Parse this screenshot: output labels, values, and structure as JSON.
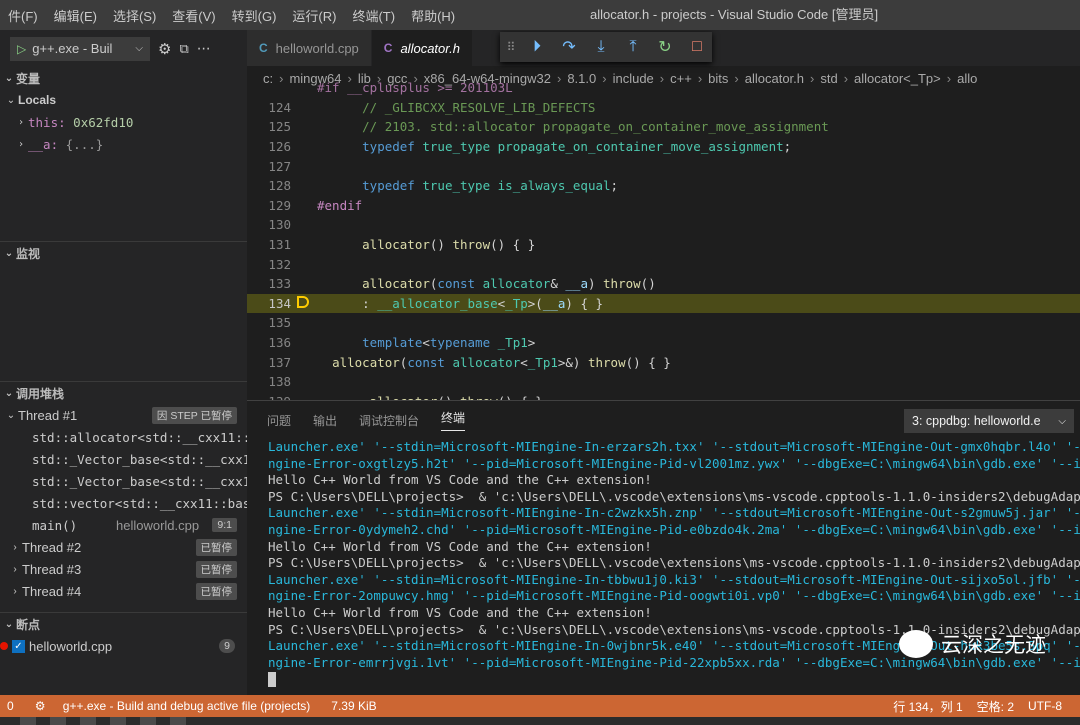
{
  "menu": [
    "件(F)",
    "编辑(E)",
    "选择(S)",
    "查看(V)",
    "转到(G)",
    "运行(R)",
    "终端(T)",
    "帮助(H)"
  ],
  "window_title": "allocator.h - projects - Visual Studio Code [管理员]",
  "sidebar": {
    "config": "g++.exe - Buil",
    "variables_title": "变量",
    "locals_title": "Locals",
    "locals": [
      {
        "name": "this:",
        "value": "0x62fd10"
      },
      {
        "name": "__a:",
        "value": "{...}"
      }
    ],
    "watch_title": "监视",
    "callstack_title": "调用堆栈",
    "thread1": {
      "label": "Thread #1",
      "badge": "因 STEP 已暂停"
    },
    "frames": [
      {
        "label": "std::allocator<std::__cxx11::b"
      },
      {
        "label": "std::_Vector_base<std::__cxx11"
      },
      {
        "label": "std::_Vector_base<std::__cxx11"
      },
      {
        "label": "std::vector<std::__cxx11::bas"
      },
      {
        "label": "main()",
        "file": "helloworld.cpp",
        "pos": "9:1"
      }
    ],
    "threads": [
      {
        "label": "Thread #2",
        "badge": "已暂停"
      },
      {
        "label": "Thread #3",
        "badge": "已暂停"
      },
      {
        "label": "Thread #4",
        "badge": "已暂停"
      }
    ],
    "breakpoints_title": "断点",
    "breakpoint": {
      "label": "helloworld.cpp",
      "count": "9"
    }
  },
  "tabs": [
    {
      "label": "helloworld.cpp",
      "icon": "C"
    },
    {
      "label": "allocator.h",
      "icon": "C"
    }
  ],
  "breadcrumbs": [
    "c:",
    "mingw64",
    "lib",
    "gcc",
    "x86_64-w64-mingw32",
    "8.1.0",
    "include",
    "c++",
    "bits",
    "allocator.h",
    "std",
    "allocator<_Tp>",
    "allo"
  ],
  "code_top_fragment": "#if __cplusplus >= 201103L",
  "code_lines": [
    {
      "n": "124",
      "html": "      <span class='cm'>// _GLIBCXX_RESOLVE_LIB_DEFECTS</span>"
    },
    {
      "n": "125",
      "html": "      <span class='cm'>// 2103. std::allocator propagate_on_container_move_assignment</span>"
    },
    {
      "n": "126",
      "html": "      <span class='k'>typedef</span> <span class='t'>true_type</span> <span class='t'>propagate_on_container_move_assignment</span>;"
    },
    {
      "n": "127",
      "html": ""
    },
    {
      "n": "128",
      "html": "      <span class='k'>typedef</span> <span class='t'>true_type</span> <span class='t'>is_always_equal</span>;"
    },
    {
      "n": "129",
      "html": "<span class='pp'>#endif</span>"
    },
    {
      "n": "130",
      "html": ""
    },
    {
      "n": "131",
      "html": "      <span class='f'>allocator</span>() <span class='f'>throw</span>() { }"
    },
    {
      "n": "132",
      "html": ""
    },
    {
      "n": "133",
      "html": "      <span class='f'>allocator</span>(<span class='k'>const</span> <span class='t'>allocator</span>&amp; <span class='v'>__a</span>) <span class='f'>throw</span>()"
    },
    {
      "n": "134",
      "html": "      : <span class='t'>__allocator_base</span>&lt;<span class='t'>_Tp</span>&gt;(<span class='v'>__a</span>) { }",
      "current": true
    },
    {
      "n": "135",
      "html": ""
    },
    {
      "n": "136",
      "html": "      <span class='k'>template</span>&lt;<span class='k'>typename</span> <span class='t'>_Tp1</span>&gt;"
    },
    {
      "n": "137",
      "html": "  <span class='f'>allocator</span>(<span class='k'>const</span> <span class='t'>allocator</span>&lt;<span class='t'>_Tp1</span>&gt;&amp;) <span class='f'>throw</span>() { }"
    },
    {
      "n": "138",
      "html": ""
    },
    {
      "n": "139",
      "html": "      <span class='f'>~allocator</span>() <span class='f'>throw</span>() { }"
    }
  ],
  "panel": {
    "tabs": [
      "问题",
      "输出",
      "调试控制台",
      "终端"
    ],
    "terminal_select": "3: cppdbg: helloworld.e",
    "lines": [
      {
        "c": true,
        "t": "Launcher.exe' '--stdin=Microsoft-MIEngine-In-erzars2h.txx' '--stdout=Microsoft-MIEngine-Out-gmx0hqbr.l4o' '-"
      },
      {
        "c": true,
        "t": "ngine-Error-oxgtlzy5.h2t' '--pid=Microsoft-MIEngine-Pid-vl2001mz.ywx' '--dbgExe=C:\\mingw64\\bin\\gdb.exe' '--i"
      },
      {
        "c": false,
        "t": "Hello C++ World from VS Code and the C++ extension!"
      },
      {
        "c": false,
        "t": "PS C:\\Users\\DELL\\projects>  & 'c:\\Users\\DELL\\.vscode\\extensions\\ms-vscode.cpptools-1.1.0-insiders2\\debugAdap"
      },
      {
        "c": true,
        "t": "Launcher.exe' '--stdin=Microsoft-MIEngine-In-c2wzkx5h.znp' '--stdout=Microsoft-MIEngine-Out-s2gmuw5j.jar' '-"
      },
      {
        "c": true,
        "t": "ngine-Error-0ydymeh2.chd' '--pid=Microsoft-MIEngine-Pid-e0bzdo4k.2ma' '--dbgExe=C:\\mingw64\\bin\\gdb.exe' '--i"
      },
      {
        "c": false,
        "t": "Hello C++ World from VS Code and the C++ extension!"
      },
      {
        "c": false,
        "t": "PS C:\\Users\\DELL\\projects>  & 'c:\\Users\\DELL\\.vscode\\extensions\\ms-vscode.cpptools-1.1.0-insiders2\\debugAdap"
      },
      {
        "c": true,
        "t": "Launcher.exe' '--stdin=Microsoft-MIEngine-In-tbbwu1j0.ki3' '--stdout=Microsoft-MIEngine-Out-sijxo5ol.jfb' '-"
      },
      {
        "c": true,
        "t": "ngine-Error-2ompuwcy.hmg' '--pid=Microsoft-MIEngine-Pid-oogwti0i.vp0' '--dbgExe=C:\\mingw64\\bin\\gdb.exe' '--i"
      },
      {
        "c": false,
        "t": "Hello C++ World from VS Code and the C++ extension!"
      },
      {
        "c": false,
        "t": "PS C:\\Users\\DELL\\projects>  & 'c:\\Users\\DELL\\.vscode\\extensions\\ms-vscode.cpptools-1.1.0-insiders2\\debugAdap"
      },
      {
        "c": true,
        "t": "Launcher.exe' '--stdin=Microsoft-MIEngine-In-0wjbnr5k.e40' '--stdout=Microsoft-MIEngine-Out-huk3be5s.5pq' '-"
      },
      {
        "c": true,
        "t": "ngine-Error-emrrjvgi.1vt' '--pid=Microsoft-MIEngine-Pid-22xpb5xx.rda' '--dbgExe=C:\\mingw64\\bin\\gdb.exe' '--i"
      }
    ]
  },
  "watermark": "云深之无迹",
  "status": {
    "left0": "0",
    "task": "g++.exe - Build and debug active file (projects)",
    "size": "7.39 KiB",
    "pos": "行 134，列 1",
    "spaces": "空格: 2",
    "encoding": "UTF-8"
  },
  "colors": {
    "status_bar": "#cc6633",
    "current_line": "#4b4b18",
    "terminal_cyan": "#29b8db"
  }
}
